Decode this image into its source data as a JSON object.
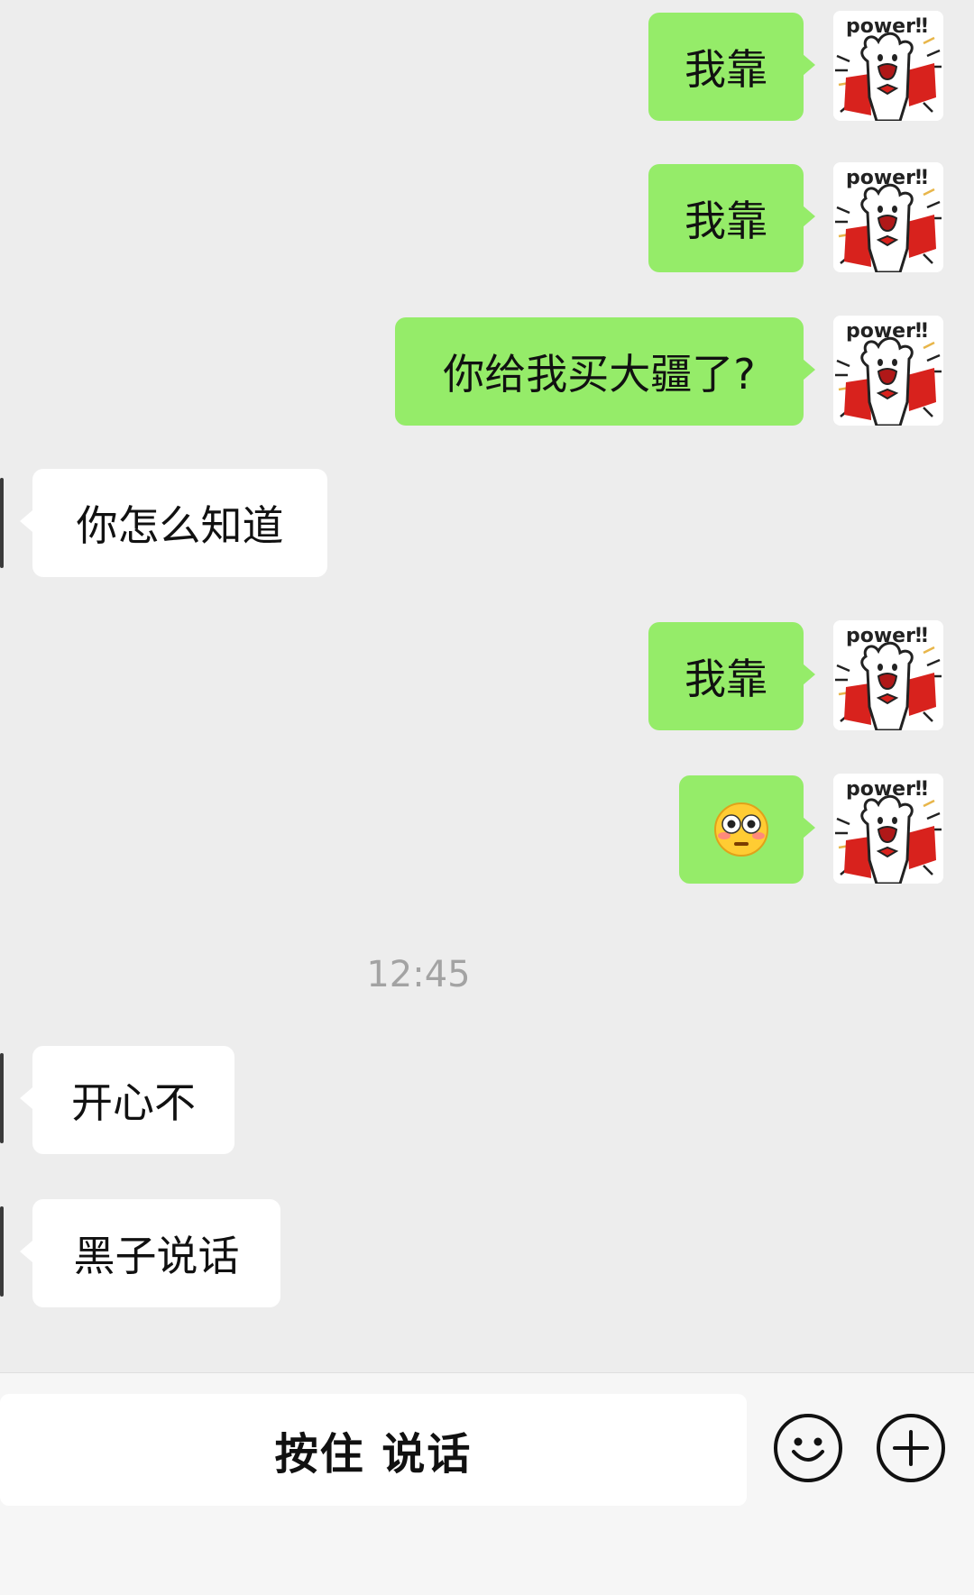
{
  "messages": [
    {
      "side": "me",
      "text": "我靠"
    },
    {
      "side": "me",
      "text": "我靠"
    },
    {
      "side": "me",
      "text": "你给我买大疆了?"
    },
    {
      "side": "other",
      "text": "你怎么知道"
    },
    {
      "side": "me",
      "text": "我靠"
    },
    {
      "side": "me",
      "emoji": "flushed-face"
    },
    {
      "side": "other",
      "text": "开心不"
    },
    {
      "side": "other",
      "text": "黑子说话"
    }
  ],
  "timestamp": "12:45",
  "avatar_text": "power‼",
  "input_bar": {
    "hold_to_talk_label": "按住 说话"
  },
  "colors": {
    "my_bubble": "#95ec69",
    "other_bubble": "#ffffff",
    "background": "#ededed",
    "sticker_red": "#d8221d"
  }
}
